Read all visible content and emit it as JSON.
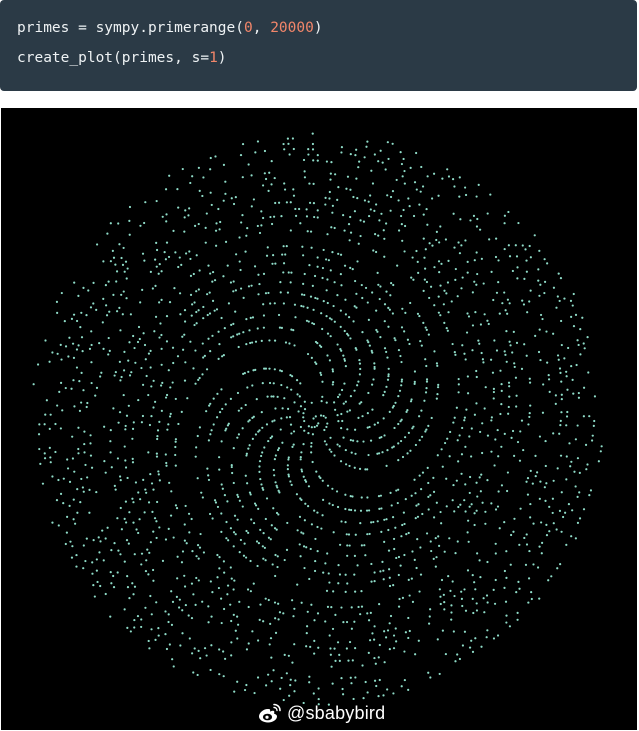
{
  "code": {
    "line1": {
      "before": "primes = sympy.primerange(",
      "arg1": "0",
      "sep": ", ",
      "arg2": "20000",
      "after": ")"
    },
    "line2": {
      "before": "create_plot(primes, s=",
      "arg": "1",
      "after": ")"
    }
  },
  "plot": {
    "description_hidden": "",
    "background_color": "#000000",
    "point_color": "#8fdcc8",
    "prime_limit": 20000
  },
  "watermark": {
    "icon": "weibo-icon",
    "text": "@sbabybird"
  },
  "colors": {
    "code_background": "#2b3a46",
    "code_text": "#eef2f4",
    "code_number": "#f2866a"
  }
}
